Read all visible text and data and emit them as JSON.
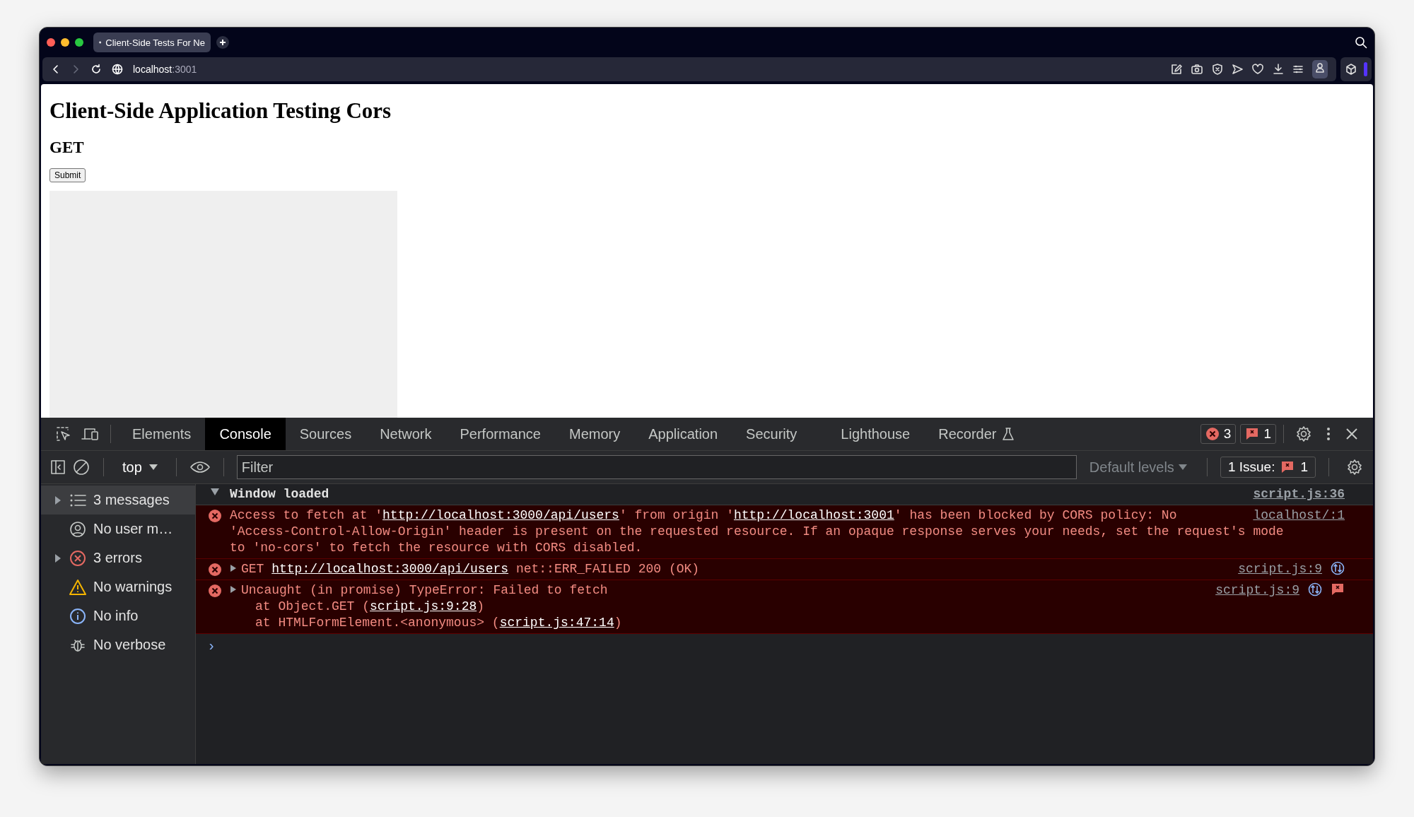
{
  "browser": {
    "tab_title": "Client-Side Tests For Ne",
    "url_host": "localhost",
    "url_port": ":3001",
    "forward_disabled": true
  },
  "page": {
    "title": "Client-Side Application Testing Cors",
    "subtitle": "GET",
    "button": "Submit"
  },
  "devtools": {
    "tabs": [
      {
        "label": "Elements",
        "selected": false
      },
      {
        "label": "Console",
        "selected": true
      },
      {
        "label": "Sources",
        "selected": false
      },
      {
        "label": "Network",
        "selected": false
      },
      {
        "label": "Performance",
        "selected": false
      },
      {
        "label": "Memory",
        "selected": false
      },
      {
        "label": "Application",
        "selected": false
      },
      {
        "label": "Security",
        "selected": false
      },
      {
        "label": "Lighthouse",
        "selected": false
      },
      {
        "label": "Recorder",
        "selected": false,
        "experimental": true
      }
    ],
    "error_count": "3",
    "issue_count": "1",
    "toolbar": {
      "context": "top",
      "filter_placeholder": "Filter",
      "levels": "Default levels",
      "issues_label": "1 Issue:",
      "issues_count": "1"
    },
    "sidebar": [
      {
        "label": "3 messages",
        "kind": "messages",
        "expandable": true,
        "selected": true
      },
      {
        "label": "No user m…",
        "kind": "user",
        "expandable": false,
        "selected": false
      },
      {
        "label": "3 errors",
        "kind": "error",
        "expandable": true,
        "selected": false
      },
      {
        "label": "No warnings",
        "kind": "warning",
        "expandable": false,
        "selected": false
      },
      {
        "label": "No info",
        "kind": "info",
        "expandable": false,
        "selected": false
      },
      {
        "label": "No verbose",
        "kind": "verbose",
        "expandable": false,
        "selected": false
      }
    ],
    "messages": [
      {
        "kind": "group",
        "expanded": true,
        "lines": [
          [
            {
              "text": "Window loaded"
            }
          ]
        ],
        "source": "script.js:36"
      },
      {
        "kind": "error",
        "lines": [
          [
            {
              "text": "Access to fetch at '"
            },
            {
              "text": "http://localhost:3000/api/users",
              "link": true
            },
            {
              "text": "' from origin '"
            },
            {
              "text": "http://localhost:3001",
              "link": true
            },
            {
              "text": "' has been blocked by CORS policy: No"
            }
          ],
          [
            {
              "text": "'Access-Control-Allow-Origin' header is present on the requested resource. If an opaque response serves your needs, set the request's mode"
            }
          ],
          [
            {
              "text": "to 'no-cors' to fetch the resource with CORS disabled."
            }
          ]
        ],
        "source": "localhost/:1"
      },
      {
        "kind": "error",
        "expandable": true,
        "expanded": false,
        "lines": [
          [
            {
              "text": "GET "
            },
            {
              "text": "http://localhost:3000/api/users",
              "link": true
            },
            {
              "text": " net::ERR_FAILED 200 (OK)"
            }
          ]
        ],
        "source": "script.js:9",
        "network": true
      },
      {
        "kind": "error",
        "expandable": true,
        "expanded": false,
        "lines": [
          [
            {
              "text": "Uncaught (in promise) TypeError: Failed to fetch"
            }
          ],
          [
            {
              "text": "at Object.GET ("
            },
            {
              "text": "script.js:9:28",
              "link": true
            },
            {
              "text": ")"
            }
          ],
          [
            {
              "text": "at HTMLFormElement.<anonymous> ("
            },
            {
              "text": "script.js:47:14",
              "link": true
            },
            {
              "text": ")"
            }
          ]
        ],
        "source": "script.js:9",
        "network": true,
        "issue": true
      }
    ],
    "prompt": "›"
  }
}
